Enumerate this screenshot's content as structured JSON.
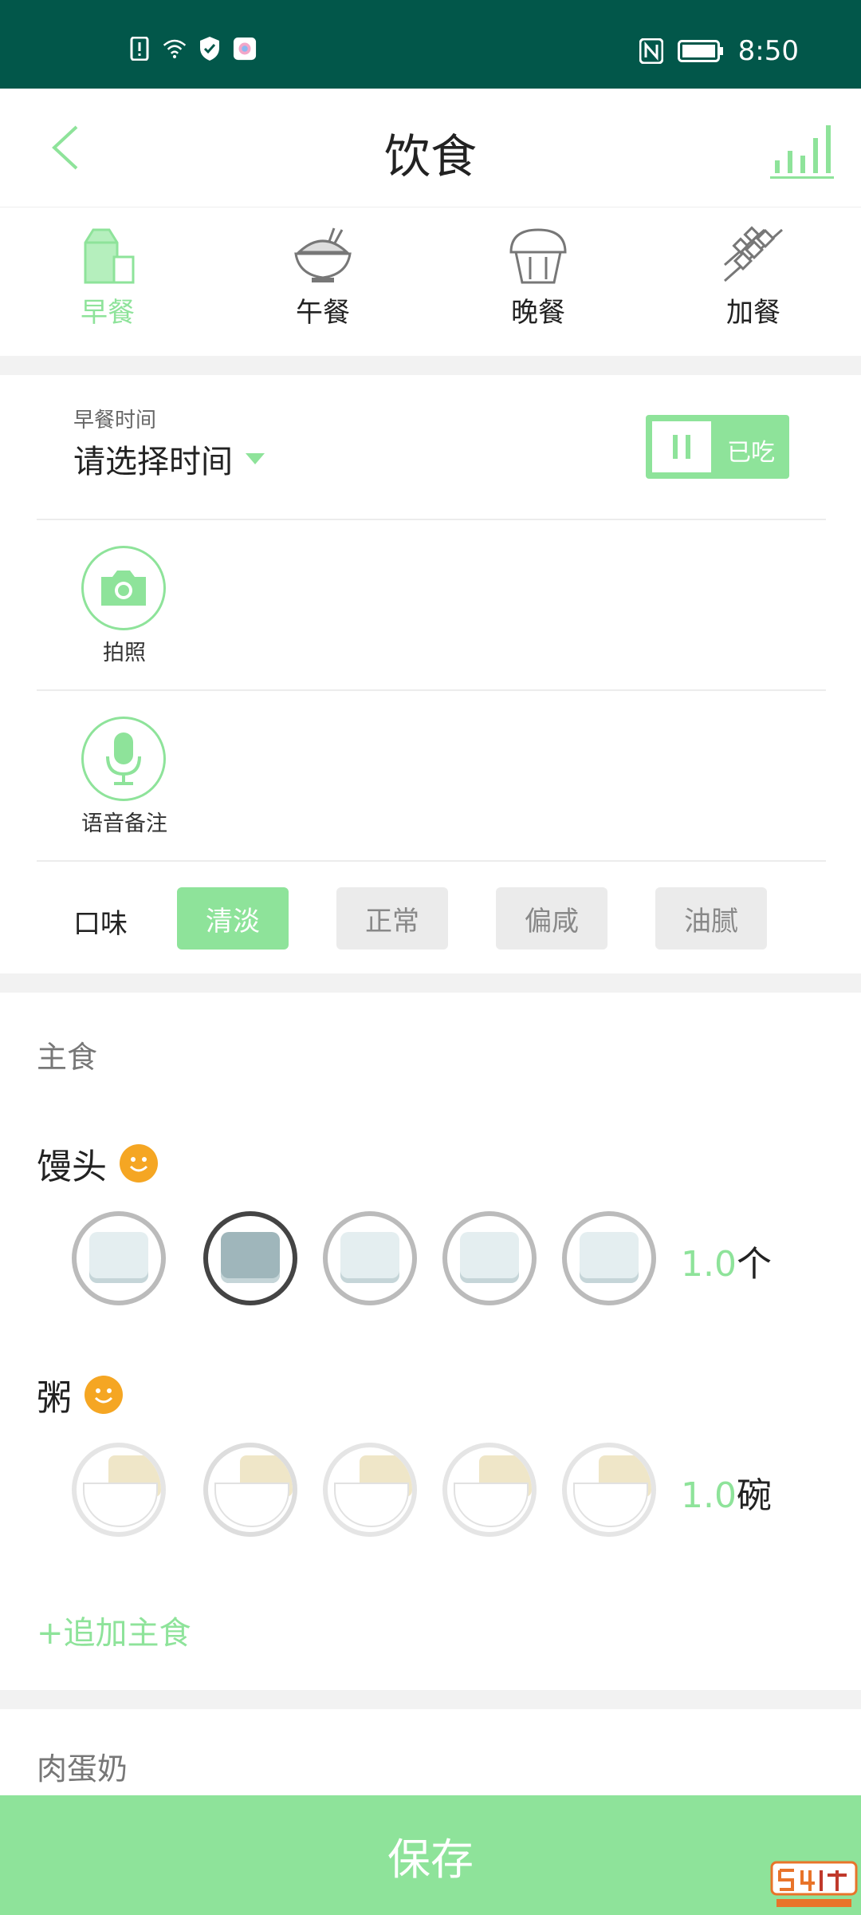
{
  "statusbar": {
    "time": "8:50"
  },
  "header": {
    "title": "饮食"
  },
  "meal_tabs": [
    {
      "label": "早餐",
      "icon": "milk-carton-icon",
      "active": true
    },
    {
      "label": "午餐",
      "icon": "rice-bowl-icon",
      "active": false
    },
    {
      "label": "晚餐",
      "icon": "cupcake-icon",
      "active": false
    },
    {
      "label": "加餐",
      "icon": "skewer-icon",
      "active": false
    }
  ],
  "meal_time": {
    "label": "早餐时间",
    "value": "请选择时间"
  },
  "eaten_toggle": {
    "label": "已吃"
  },
  "photo": {
    "label": "拍照"
  },
  "voice": {
    "label": "语音备注"
  },
  "taste": {
    "label": "口味",
    "options": [
      "清淡",
      "正常",
      "偏咸",
      "油腻"
    ],
    "selected": "清淡"
  },
  "staple": {
    "section_title": "主食",
    "items": [
      {
        "name": "馒头",
        "qty": "1.0",
        "unit": "个",
        "selected_portion": 2
      },
      {
        "name": "粥",
        "qty": "1.0",
        "unit": "碗",
        "selected_portion": 2
      }
    ],
    "add_label": "+追加主食"
  },
  "protein": {
    "section_title": "肉蛋奶"
  },
  "save": {
    "label": "保存"
  },
  "colors": {
    "accent": "#8ee39a",
    "statusbar": "#02574a",
    "smiley": "#f5a623"
  }
}
